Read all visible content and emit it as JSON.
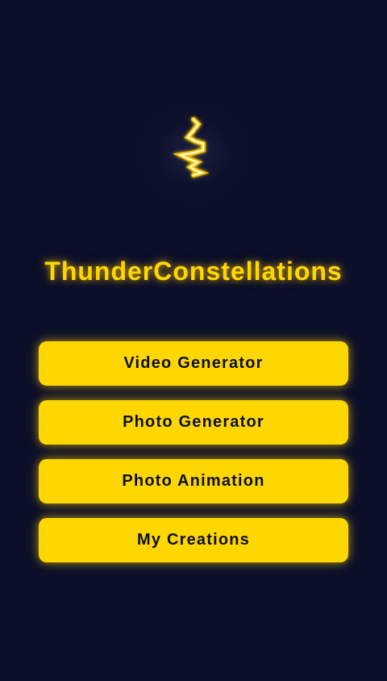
{
  "app": {
    "title": "ThunderConstellations",
    "logo_icon": "lightning-bolt-icon"
  },
  "menu": {
    "items": [
      {
        "label": "Video Generator"
      },
      {
        "label": "Photo Generator"
      },
      {
        "label": "Photo Animation"
      },
      {
        "label": "My Creations"
      }
    ]
  },
  "colors": {
    "background": "#0b0f29",
    "accent": "#ffd700",
    "button_text": "#0b0f29"
  }
}
